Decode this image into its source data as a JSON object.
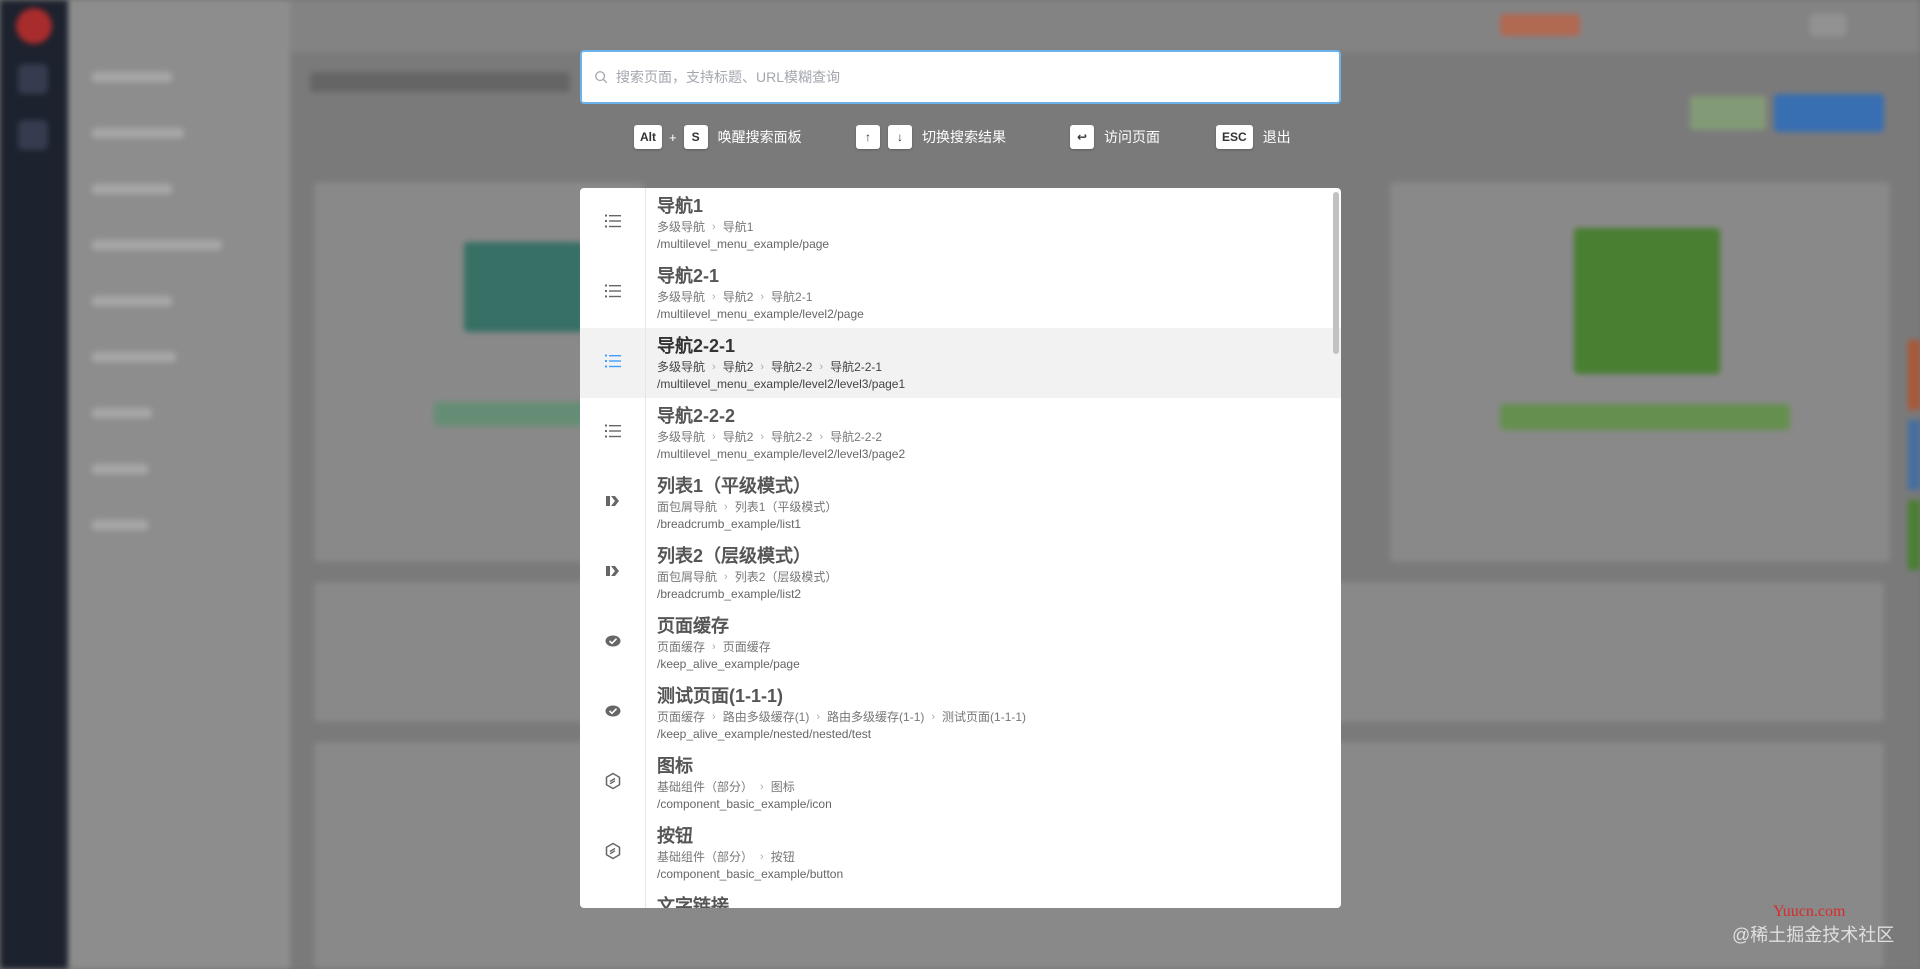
{
  "search": {
    "placeholder": "搜索页面，支持标题、URL模糊查询",
    "value": ""
  },
  "hints": [
    {
      "keys": [
        "Alt",
        "S"
      ],
      "joiner": "+",
      "label": "唤醒搜索面板"
    },
    {
      "keys": [
        "↑",
        "↓"
      ],
      "joiner": "",
      "label": "切换搜索结果"
    },
    {
      "keys": [
        "↩"
      ],
      "joiner": "",
      "label": "访问页面"
    },
    {
      "keys": [
        "ESC"
      ],
      "joiner": "",
      "label": "退出"
    }
  ],
  "results": [
    {
      "title": "导航1",
      "icon": "list-icon",
      "crumbs": [
        "多级导航",
        "导航1"
      ],
      "path": "/multilevel_menu_example/page",
      "active": false
    },
    {
      "title": "导航2-1",
      "icon": "list-icon",
      "crumbs": [
        "多级导航",
        "导航2",
        "导航2-1"
      ],
      "path": "/multilevel_menu_example/level2/page",
      "active": false
    },
    {
      "title": "导航2-2-1",
      "icon": "list-icon",
      "crumbs": [
        "多级导航",
        "导航2",
        "导航2-2",
        "导航2-2-1"
      ],
      "path": "/multilevel_menu_example/level2/level3/page1",
      "active": true
    },
    {
      "title": "导航2-2-2",
      "icon": "list-icon",
      "crumbs": [
        "多级导航",
        "导航2",
        "导航2-2",
        "导航2-2-2"
      ],
      "path": "/multilevel_menu_example/level2/level3/page2",
      "active": false
    },
    {
      "title": "列表1（平级模式）",
      "icon": "breadcrumb-icon",
      "crumbs": [
        "面包屑导航",
        "列表1（平级模式）"
      ],
      "path": "/breadcrumb_example/list1",
      "active": false
    },
    {
      "title": "列表2（层级模式）",
      "icon": "breadcrumb-icon",
      "crumbs": [
        "面包屑导航",
        "列表2（层级模式）"
      ],
      "path": "/breadcrumb_example/list2",
      "active": false
    },
    {
      "title": "页面缓存",
      "icon": "cache-icon",
      "crumbs": [
        "页面缓存",
        "页面缓存"
      ],
      "path": "/keep_alive_example/page",
      "active": false
    },
    {
      "title": "测试页面(1-1-1)",
      "icon": "cache-icon",
      "crumbs": [
        "页面缓存",
        "路由多级缓存(1)",
        "路由多级缓存(1-1)",
        "测试页面(1-1-1)"
      ],
      "path": "/keep_alive_example/nested/nested/test",
      "active": false
    },
    {
      "title": "图标",
      "icon": "component-icon",
      "crumbs": [
        "基础组件（部分）",
        "图标"
      ],
      "path": "/component_basic_example/icon",
      "active": false
    },
    {
      "title": "按钮",
      "icon": "component-icon",
      "crumbs": [
        "基础组件（部分）",
        "按钮"
      ],
      "path": "/component_basic_example/button",
      "active": false
    },
    {
      "title": "文字链接",
      "icon": "component-icon",
      "crumbs": [],
      "path": "",
      "active": false
    }
  ],
  "watermark": {
    "site": "Yuucn.com",
    "text": "@稀土掘金技术社区"
  },
  "colors": {
    "accent": "#409eff",
    "search_border": "#6bb3ea",
    "active_row": "#f2f2f3"
  }
}
